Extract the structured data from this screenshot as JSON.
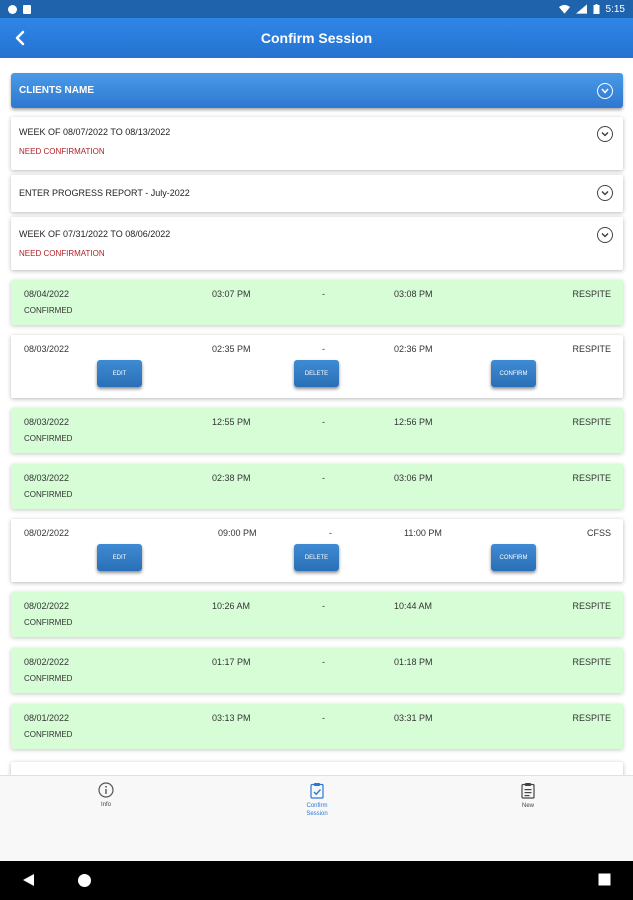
{
  "status_bar": {
    "time": "5:15"
  },
  "header": {
    "title": "Confirm Session"
  },
  "client": {
    "label": "CLIENTS NAME"
  },
  "weeks": [
    {
      "title": "WEEK OF 08/07/2022 TO 08/13/2022",
      "status": "NEED CONFIRMATION"
    },
    {
      "title": "ENTER PROGRESS REPORT - July-2022"
    },
    {
      "title": "WEEK OF 07/31/2022 TO 08/06/2022",
      "status": "NEED CONFIRMATION"
    }
  ],
  "sessions": [
    {
      "date": "08/04/2022",
      "start": "03:07 PM",
      "sep": "-",
      "end": "03:08 PM",
      "type": "RESPITE",
      "status": "CONFIRMED"
    },
    {
      "date": "08/03/2022",
      "start": "02:35 PM",
      "sep": "-",
      "end": "02:36 PM",
      "type": "RESPITE",
      "edit": "EDIT",
      "delete": "DELETE",
      "confirm": "CONFIRM"
    },
    {
      "date": "08/03/2022",
      "start": "12:55 PM",
      "sep": "-",
      "end": "12:56 PM",
      "type": "RESPITE",
      "status": "CONFIRMED"
    },
    {
      "date": "08/03/2022",
      "start": "02:38 PM",
      "sep": "-",
      "end": "03:06 PM",
      "type": "RESPITE",
      "status": "CONFIRMED"
    },
    {
      "date": "08/02/2022",
      "start": "09:00 PM",
      "sep": "-",
      "end": "11:00 PM",
      "type": "CFSS",
      "edit": "EDIT",
      "delete": "DELETE",
      "confirm": "CONFIRM"
    },
    {
      "date": "08/02/2022",
      "start": "10:26 AM",
      "sep": "-",
      "end": "10:44 AM",
      "type": "RESPITE",
      "status": "CONFIRMED"
    },
    {
      "date": "08/02/2022",
      "start": "01:17 PM",
      "sep": "-",
      "end": "01:18 PM",
      "type": "RESPITE",
      "status": "CONFIRMED"
    },
    {
      "date": "08/01/2022",
      "start": "03:13 PM",
      "sep": "-",
      "end": "03:31 PM",
      "type": "RESPITE",
      "status": "CONFIRMED"
    }
  ],
  "tabs": [
    {
      "label": "Info",
      "icon": "info-icon"
    },
    {
      "label": "Confirm Session",
      "icon": "clipboard-check-icon",
      "active": true
    },
    {
      "label": "New",
      "icon": "clipboard-icon"
    }
  ],
  "colors": {
    "primary": "#2572cf",
    "status_bar": "#1f63ad",
    "confirmed_bg": "#d7fdd7",
    "need_confirmation": "#b0202a",
    "button": "#2a6fb6",
    "active_tab": "#2a78d6"
  }
}
